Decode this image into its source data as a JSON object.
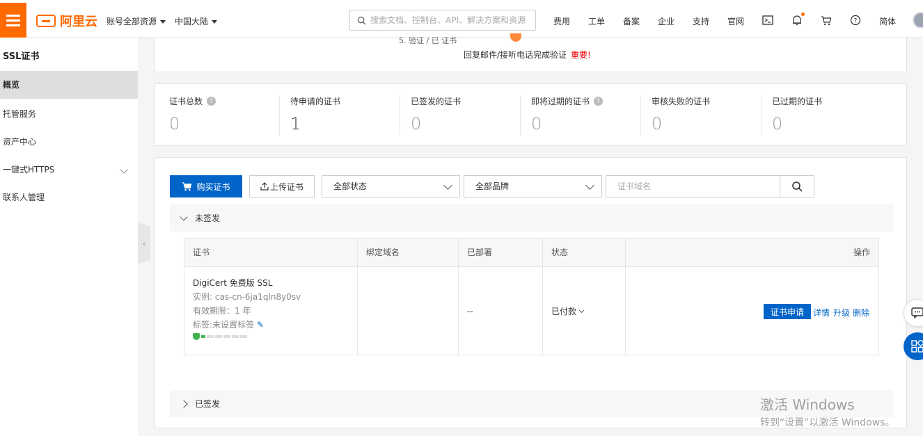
{
  "header": {
    "logo_text": "阿里云",
    "all_resources": "账号全部资源",
    "region": "中国大陆",
    "search_placeholder": "搜索文档、控制台、API、解决方案和资源",
    "links": [
      "费用",
      "工单",
      "备案",
      "企业",
      "支持",
      "官网"
    ],
    "lang": "简体",
    "accent_color": "#ff6a00"
  },
  "sidebar": {
    "title": "SSL证书",
    "items": [
      {
        "label": "概览",
        "active": true
      },
      {
        "label": "托管服务",
        "active": false
      },
      {
        "label": "资产中心",
        "active": false
      },
      {
        "label": "一键式HTTPS",
        "active": false,
        "expandable": true
      },
      {
        "label": "联系人管理",
        "active": false
      }
    ]
  },
  "verify": {
    "top_partial": "5. 验证 / 已 证书",
    "text": "回复邮件/接听电话完成验证",
    "important": "重要!"
  },
  "stats": [
    {
      "label": "证书总数",
      "value": "0",
      "help": true
    },
    {
      "label": "待申请的证书",
      "value": "1",
      "help": false
    },
    {
      "label": "已签发的证书",
      "value": "0",
      "help": false
    },
    {
      "label": "即将过期的证书",
      "value": "0",
      "help": true
    },
    {
      "label": "审核失败的证书",
      "value": "0",
      "help": false
    },
    {
      "label": "已过期的证书",
      "value": "0",
      "help": false
    }
  ],
  "toolbar": {
    "buy_label": "购买证书",
    "upload_label": "上传证书",
    "status_select": "全部状态",
    "brand_select": "全部品牌",
    "domain_placeholder": "证书域名"
  },
  "groups": {
    "unsigned": "未签发",
    "signed": "已签发"
  },
  "table": {
    "headers": [
      "证书",
      "绑定域名",
      "已部署",
      "状态",
      "操作"
    ],
    "row": {
      "name": "DigiCert 免费版 SSL",
      "instance": "实例: cas-cn-6ja1qln8y0sv",
      "validity": "有效期限：1 年",
      "tags": "标签:未设置标签",
      "progress_steps_done": 1,
      "progress_steps_total": 6,
      "domain": "",
      "deployed": "--",
      "status": "已付款",
      "apply_label": "证书申请",
      "actions": [
        "详情",
        "升级",
        "删除"
      ]
    }
  },
  "watermark": {
    "line1": "激活 Windows",
    "line2": "转到“设置”以激活 Windows。"
  }
}
